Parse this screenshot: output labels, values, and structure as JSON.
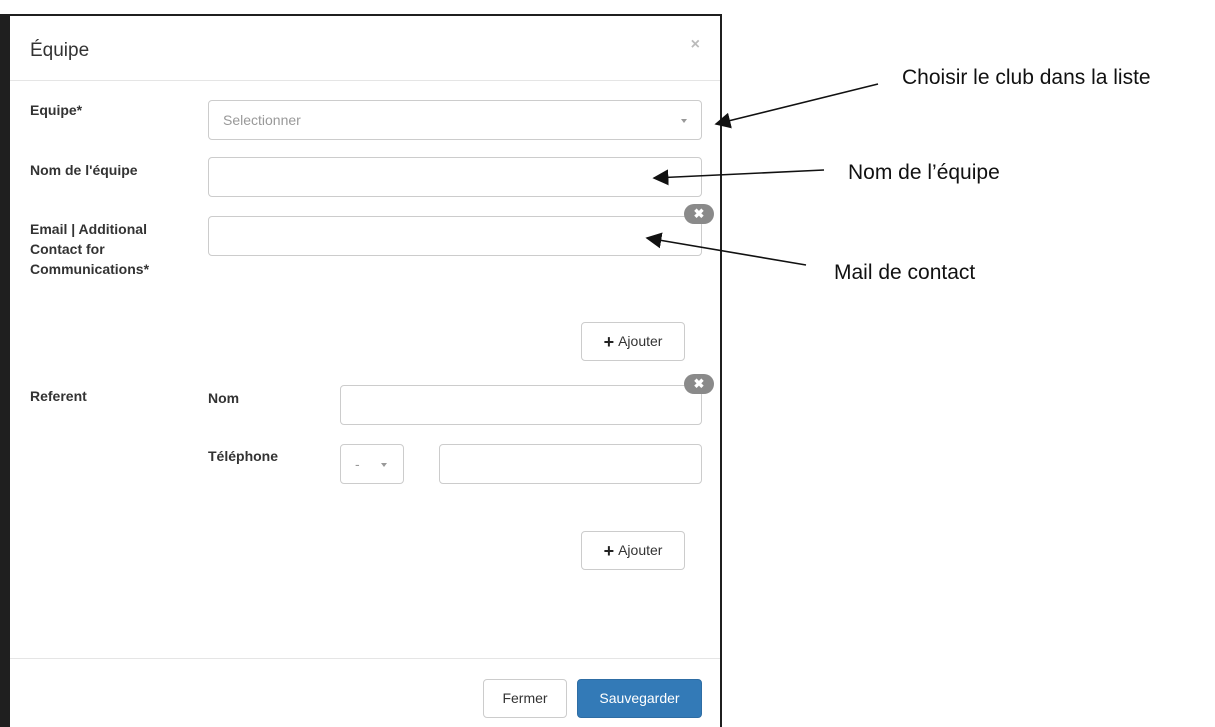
{
  "modal": {
    "title": "Équipe",
    "close_glyph": "×",
    "fields": {
      "team_label": "Equipe*",
      "team_placeholder": "Selectionner",
      "team_name_label": "Nom de l'équipe",
      "team_name_value": "",
      "email_label_line1": "Email | Additional",
      "email_label_line2": "Contact for",
      "email_label_line3": "Communications*",
      "email_value": "",
      "add_label_1": "Ajouter",
      "referent_label": "Referent",
      "referent_name_label": "Nom",
      "referent_name_value": "",
      "phone_label": "Téléphone",
      "phone_prefix": "-",
      "phone_value": "",
      "add_label_2": "Ajouter"
    },
    "footer": {
      "close_label": "Fermer",
      "save_label": "Sauvegarder"
    },
    "remove_glyph": "✖"
  },
  "annotations": {
    "club": "Choisir le club dans la liste",
    "team_name": "Nom de l’équipe",
    "mail": "Mail de contact"
  },
  "colors": {
    "primary": "#337ab7",
    "backdrop": "#1f1f1f"
  }
}
